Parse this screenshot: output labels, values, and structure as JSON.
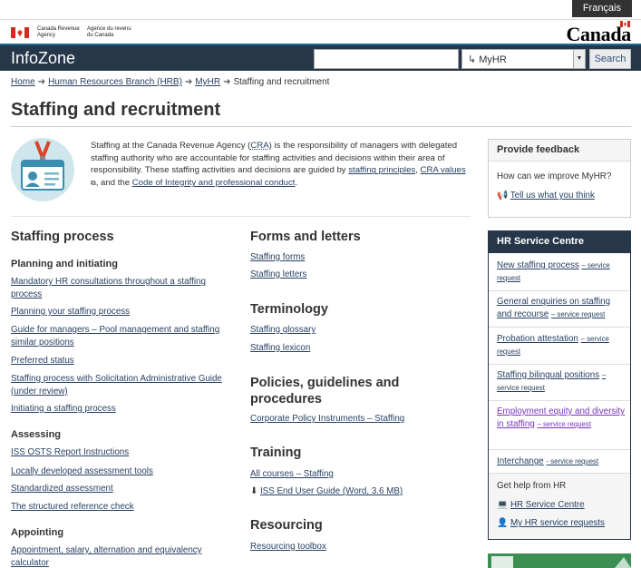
{
  "header": {
    "lang_toggle": "Français",
    "agency_en_line1": "Canada Revenue",
    "agency_en_line2": "Agency",
    "agency_fr_line1": "Agence du revenu",
    "agency_fr_line2": "du Canada",
    "wordmark": "Canada"
  },
  "appbar": {
    "title": "InfoZone",
    "search_value": "",
    "scope_value": "↳ MyHR",
    "search_button": "Search"
  },
  "breadcrumb": [
    "Home",
    "Human Resources Branch (HRB)",
    "MyHR",
    "Staffing and recruitment"
  ],
  "page_title": "Staffing and recruitment",
  "intro": {
    "text_1": "Staffing at the Canada Revenue Agency (",
    "cra_abbr": "CRA",
    "text_2": ") is the responsibility of managers with delegated staffing authority who are accountable for staffing activities and decisions within their area of responsibility. These staffing activities and decisions are guided by ",
    "link_principles": "staffing principles",
    "text_3": ", ",
    "link_values": "CRA values",
    "text_4": ", and the ",
    "link_code": "Code of Integrity and professional conduct",
    "text_5": "."
  },
  "staffing_process": {
    "heading": "Staffing process",
    "planning": {
      "heading": "Planning and initiating",
      "links": [
        "Mandatory HR consultations throughout a staffing process",
        "Planning your staffing process",
        "Guide for managers – Pool management and staffing similar positions",
        "Preferred status",
        "Staffing process with Solicitation Administrative Guide (under review)",
        "Initiating a staffing process"
      ]
    },
    "assessing": {
      "heading": "Assessing",
      "links": [
        "ISS OSTS Report Instructions",
        "Locally developed assessment tools",
        "Standardized assessment",
        "The structured reference check"
      ]
    },
    "appointing": {
      "heading": "Appointing",
      "links": [
        "Appointment, salary, alternation and equivalency calculator"
      ]
    }
  },
  "forms": {
    "heading": "Forms and letters",
    "links": [
      "Staffing forms",
      "Staffing letters"
    ]
  },
  "terminology": {
    "heading": "Terminology",
    "links": [
      "Staffing glossary",
      "Staffing lexicon"
    ]
  },
  "policies": {
    "heading": "Policies, guidelines and procedures",
    "links": [
      "Corporate Policy Instruments – Staffing"
    ]
  },
  "training": {
    "heading": "Training",
    "links": [
      "All courses – Staffing",
      "ISS End User Guide (Word, 3.6 MB)"
    ]
  },
  "resourcing": {
    "heading": "Resourcing",
    "links": [
      "Resourcing toolbox"
    ]
  },
  "feedback": {
    "heading": "Provide feedback",
    "question": "How can we improve MyHR?",
    "link": "Tell us what you think"
  },
  "hr_service_centre": {
    "heading": "HR Service Centre",
    "items": [
      {
        "label": "New staffing process",
        "suffix": "– service request"
      },
      {
        "label": "General enquiries on staffing and recourse",
        "suffix": "– service request"
      },
      {
        "label": "Probation attestation",
        "suffix": "– service request"
      },
      {
        "label": "Staffing bilingual positions",
        "suffix": "– service request"
      },
      {
        "label": "Employment equity and diversity in staffing",
        "suffix": "– service request"
      },
      {
        "label": "Interchange",
        "suffix": "- service request"
      }
    ],
    "help_text": "Get help from HR",
    "help_links": [
      "HR Service Centre",
      "My HR service requests"
    ]
  },
  "colors": {
    "appbar": "#26374a",
    "link": "#284162",
    "visited": "#7834bc",
    "accent": "#1b6c8f"
  }
}
